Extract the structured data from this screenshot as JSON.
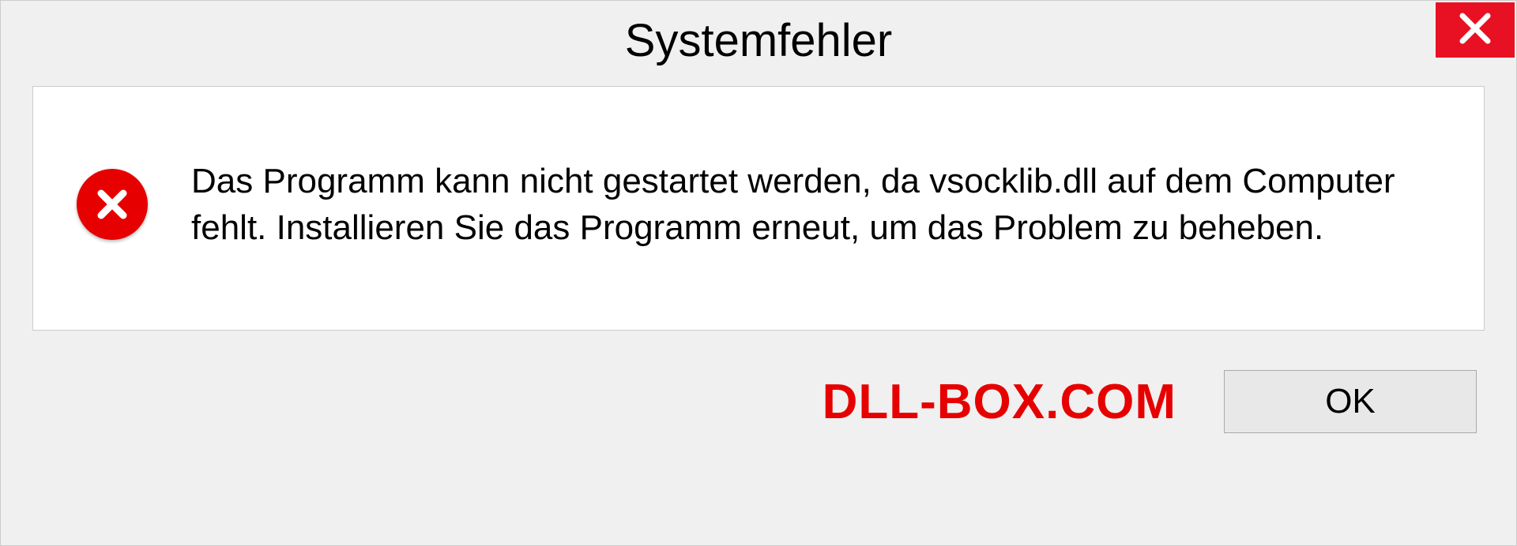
{
  "dialog": {
    "title": "Systemfehler",
    "message": "Das Programm kann nicht gestartet werden, da vsocklib.dll auf dem Computer fehlt. Installieren Sie das Programm erneut, um das Problem zu beheben.",
    "ok_label": "OK"
  },
  "watermark": "DLL-BOX.COM"
}
